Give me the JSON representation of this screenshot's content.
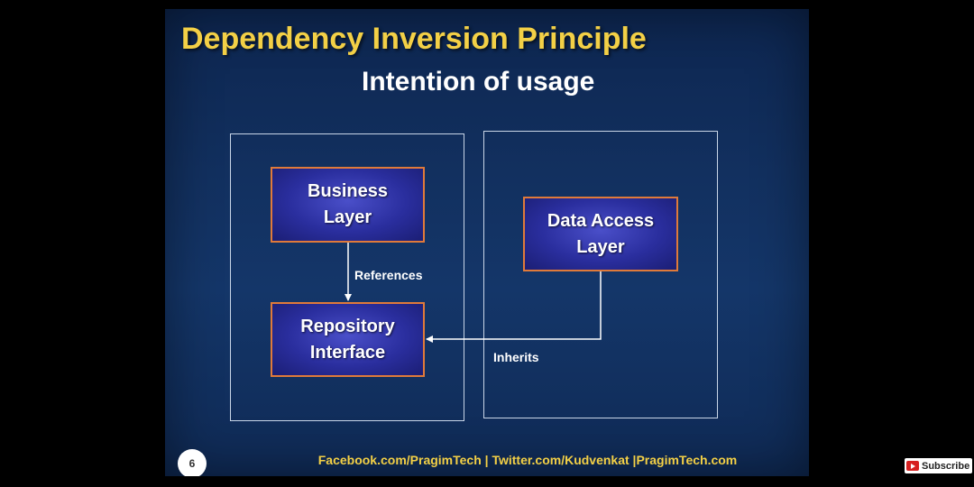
{
  "slide": {
    "title": "Dependency Inversion Principle",
    "subtitle": "Intention of usage",
    "page_number": "6",
    "footer": "Facebook.com/PragimTech | Twitter.com/Kudvenkat |PragimTech.com",
    "colors": {
      "title": "#f3d046",
      "background": "#12305f",
      "box_border": "#e07a3a",
      "box_fill": "#2a2e9e"
    }
  },
  "diagram": {
    "boxes": {
      "business_layer": "Business\nLayer",
      "repository_interface": "Repository\nInterface",
      "data_access_layer": "Data Access\nLayer"
    },
    "connectors": {
      "references": "References",
      "inherits": "Inherits"
    }
  },
  "player": {
    "subscribe_label": "Subscribe",
    "subscribe_icon": "youtube-play-icon"
  }
}
